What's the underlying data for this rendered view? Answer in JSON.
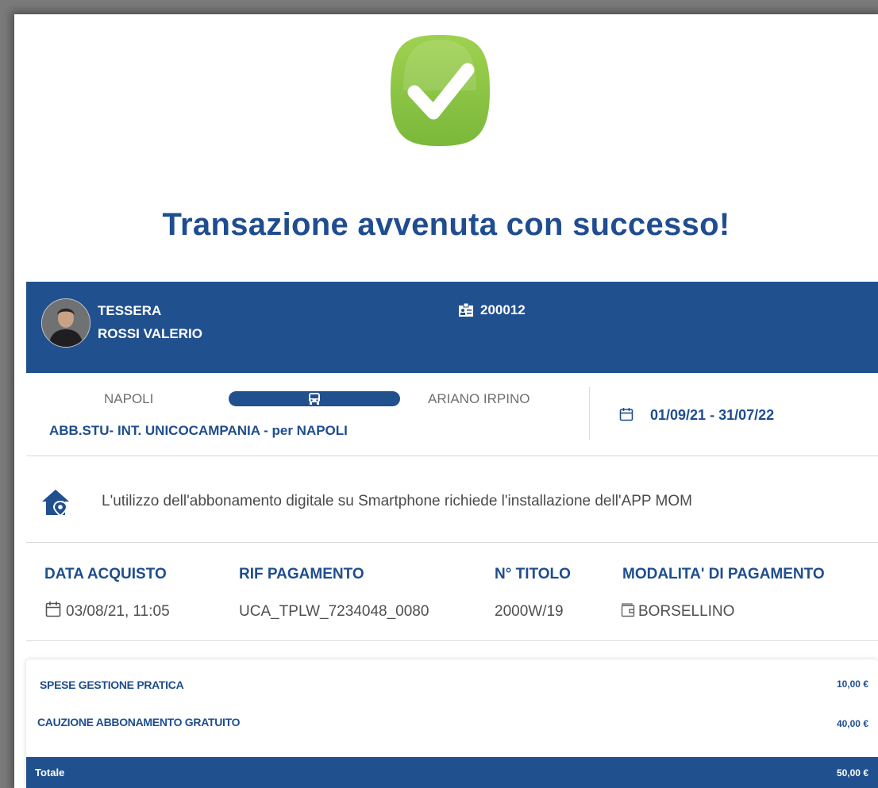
{
  "title": "Transazione avvenuta con successo!",
  "colors": {
    "primary": "#21508f",
    "success": "#8cc63f",
    "text_blue": "#1f4d8f"
  },
  "icons": {
    "success": "check-badge-icon",
    "card": "id-card-icon",
    "route": "bus-icon",
    "validity": "calendar-icon",
    "info": "home-location-icon",
    "purchase_date": "calendar-icon",
    "payment_method": "wallet-icon"
  },
  "card": {
    "type": "TESSERA",
    "holder_name": "ROSSI VALERIO",
    "number": "200012"
  },
  "route": {
    "from": "NAPOLI",
    "to": "ARIANO IRPINO",
    "product_name": "ABB.STU- INT. UNICOCAMPANIA - per NAPOLI",
    "validity": "01/09/21 - 31/07/22"
  },
  "info_message": "L'utilizzo dell'abbonamento digitale su Smartphone richiede l'installazione dell'APP MOM",
  "details": {
    "purchase_date_label": "DATA ACQUISTO",
    "purchase_date": "03/08/21, 11:05",
    "payment_ref_label": "RIF PAGAMENTO",
    "payment_ref": "UCA_TPLW_7234048_0080",
    "title_number_label": "N° TITOLO",
    "title_number": "2000W/19",
    "payment_method_label": "MODALITA' DI PAGAMENTO",
    "payment_method": "BORSELLINO"
  },
  "summary": {
    "items": [
      {
        "label": "SPESE GESTIONE PRATICA",
        "amount": "10,00 €"
      },
      {
        "label": "CAUZIONE ABBONAMENTO GRATUITO",
        "amount": "40,00 €"
      }
    ],
    "total_label": "Totale",
    "total_amount": "50,00 €"
  }
}
